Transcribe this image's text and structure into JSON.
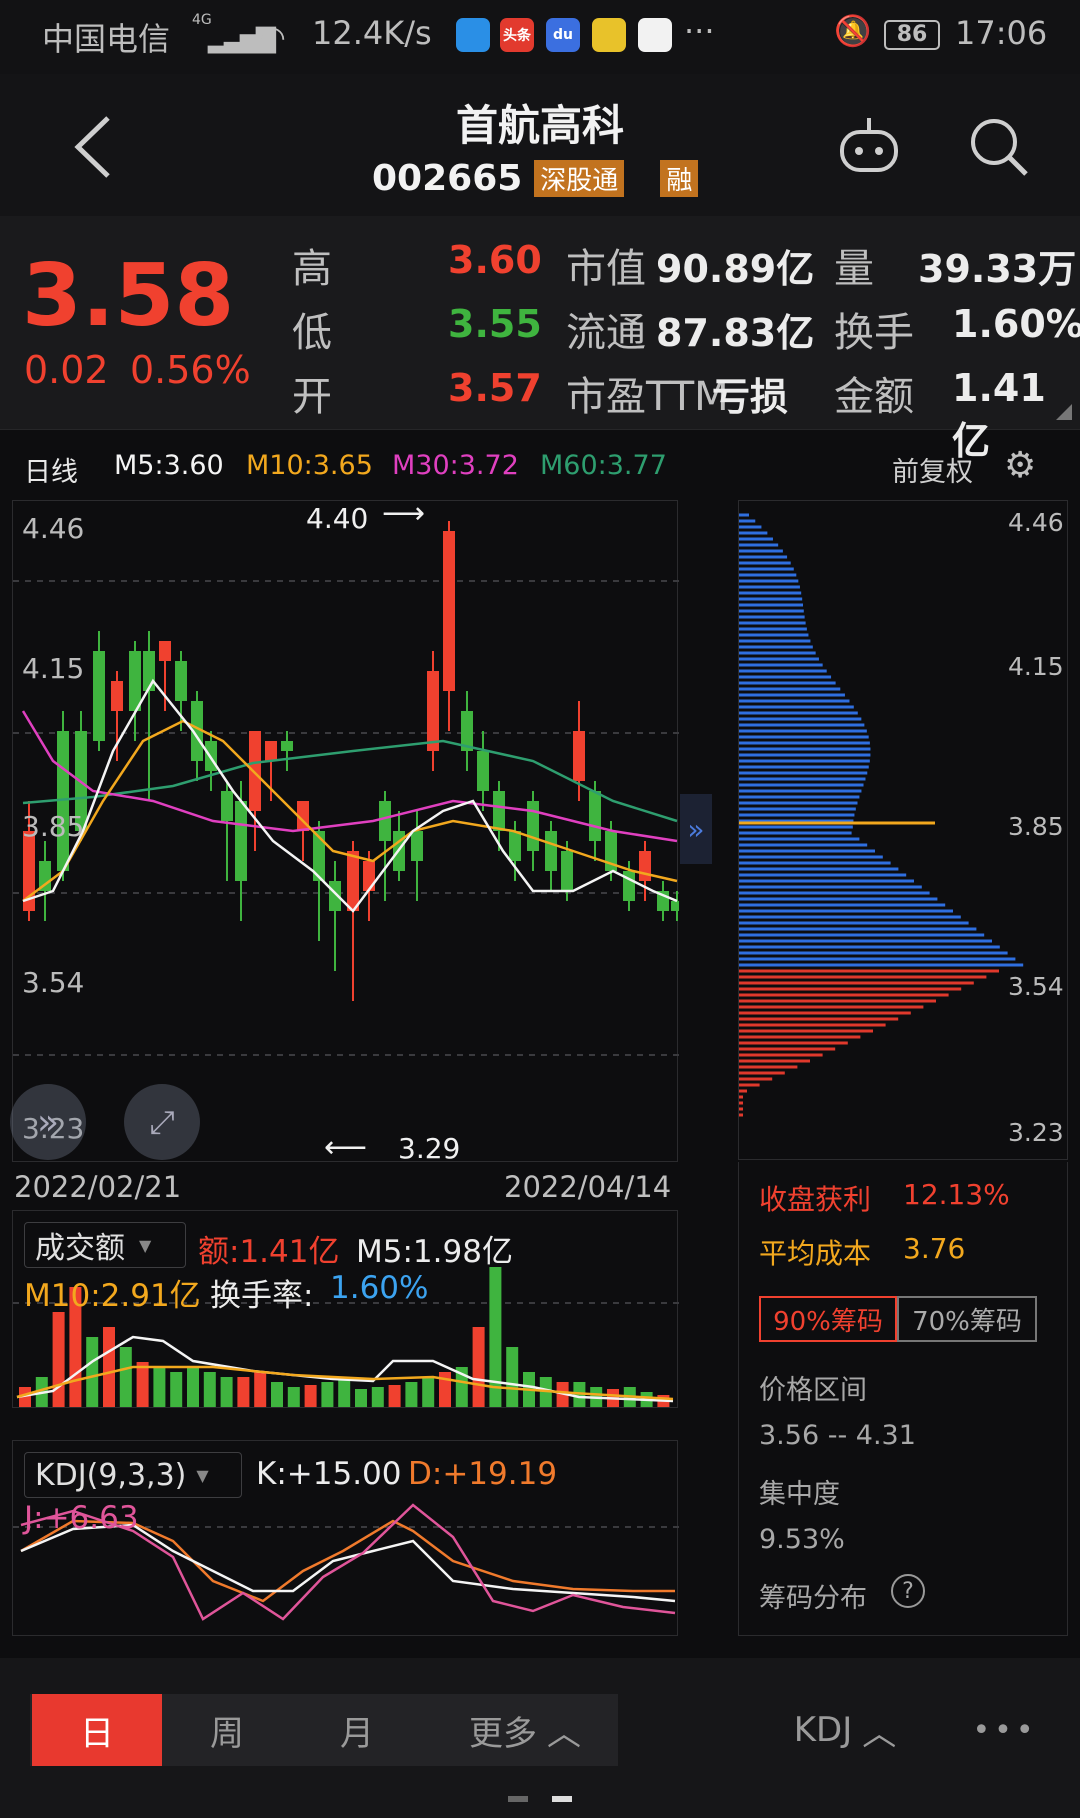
{
  "status": {
    "carrier": "中国电信",
    "network": "4G",
    "speed": "12.4K/s",
    "apps": [
      {
        "label": "",
        "color": "#2a8fe6"
      },
      {
        "label": "头条",
        "color": "#e23a2e"
      },
      {
        "label": "du",
        "color": "#3b6fe0"
      },
      {
        "label": "",
        "color": "#e8c22a"
      },
      {
        "label": "",
        "color": "#f2f2f2"
      }
    ],
    "more": "···",
    "battery": "86",
    "time": "17:06"
  },
  "header": {
    "title": "首航高科",
    "code": "002665",
    "badge_connect": "深股通",
    "badge_margin": "融"
  },
  "quote": {
    "price": "3.58",
    "change": "0.02",
    "change_pct": "0.56%",
    "rows": [
      {
        "label": "高",
        "value": "3.60",
        "k1": "市值",
        "v1": "90.89亿",
        "k2": "量",
        "v2": "39.33万"
      },
      {
        "label": "低",
        "value": "3.55",
        "k1": "流通",
        "v1": "87.83亿",
        "k2": "换手",
        "v2": "1.60%"
      },
      {
        "label": "开",
        "value": "3.57",
        "k1": "市盈TTM",
        "v1": "亏损",
        "k2": "金额",
        "v2": "1.41亿"
      }
    ]
  },
  "kline": {
    "period": "日线",
    "ma5": "M5:3.60",
    "ma10": "M10:3.65",
    "ma30": "M30:3.72",
    "ma60": "M60:3.77",
    "adjust": "前复权",
    "y_labels": [
      "4.46",
      "4.15",
      "3.85",
      "3.54",
      "3.23"
    ],
    "high_marker": "4.40",
    "low_marker": "3.29",
    "date_start": "2022/02/21",
    "date_end": "2022/04/14",
    "colors": {
      "up": "#f0412f",
      "down": "#3fb43f",
      "ma5": "#f4f4f4",
      "ma10": "#f2a81e",
      "ma30": "#e040c0",
      "ma60": "#2e9e6f"
    }
  },
  "chips": {
    "y_labels": [
      "4.46",
      "4.15",
      "3.85",
      "3.54",
      "3.23"
    ],
    "profit_label": "收盘获利",
    "profit_value": "12.13%",
    "avg_cost_label": "平均成本",
    "avg_cost_value": "3.76",
    "tab_90": "90%筹码",
    "tab_70": "70%筹码",
    "range_label": "价格区间",
    "range_value": "3.56 -- 4.31",
    "concentration_label": "集中度",
    "concentration_value": "9.53%",
    "dist_label": "筹码分布",
    "help": "?"
  },
  "volume": {
    "selector": "成交额",
    "amount": "额:1.41亿",
    "m5": "M5:1.98亿",
    "m10": "M10:2.91亿",
    "turnover_label": "换手率:",
    "turnover_value": "1.60%"
  },
  "kdj": {
    "selector": "KDJ(9,3,3)",
    "k": "K:+15.00",
    "d": "D:+19.19",
    "j": "J:+6.63"
  },
  "bottom": {
    "tabs": [
      "日",
      "周",
      "月",
      "更多"
    ],
    "indicator": "KDJ",
    "more": "•••"
  }
}
